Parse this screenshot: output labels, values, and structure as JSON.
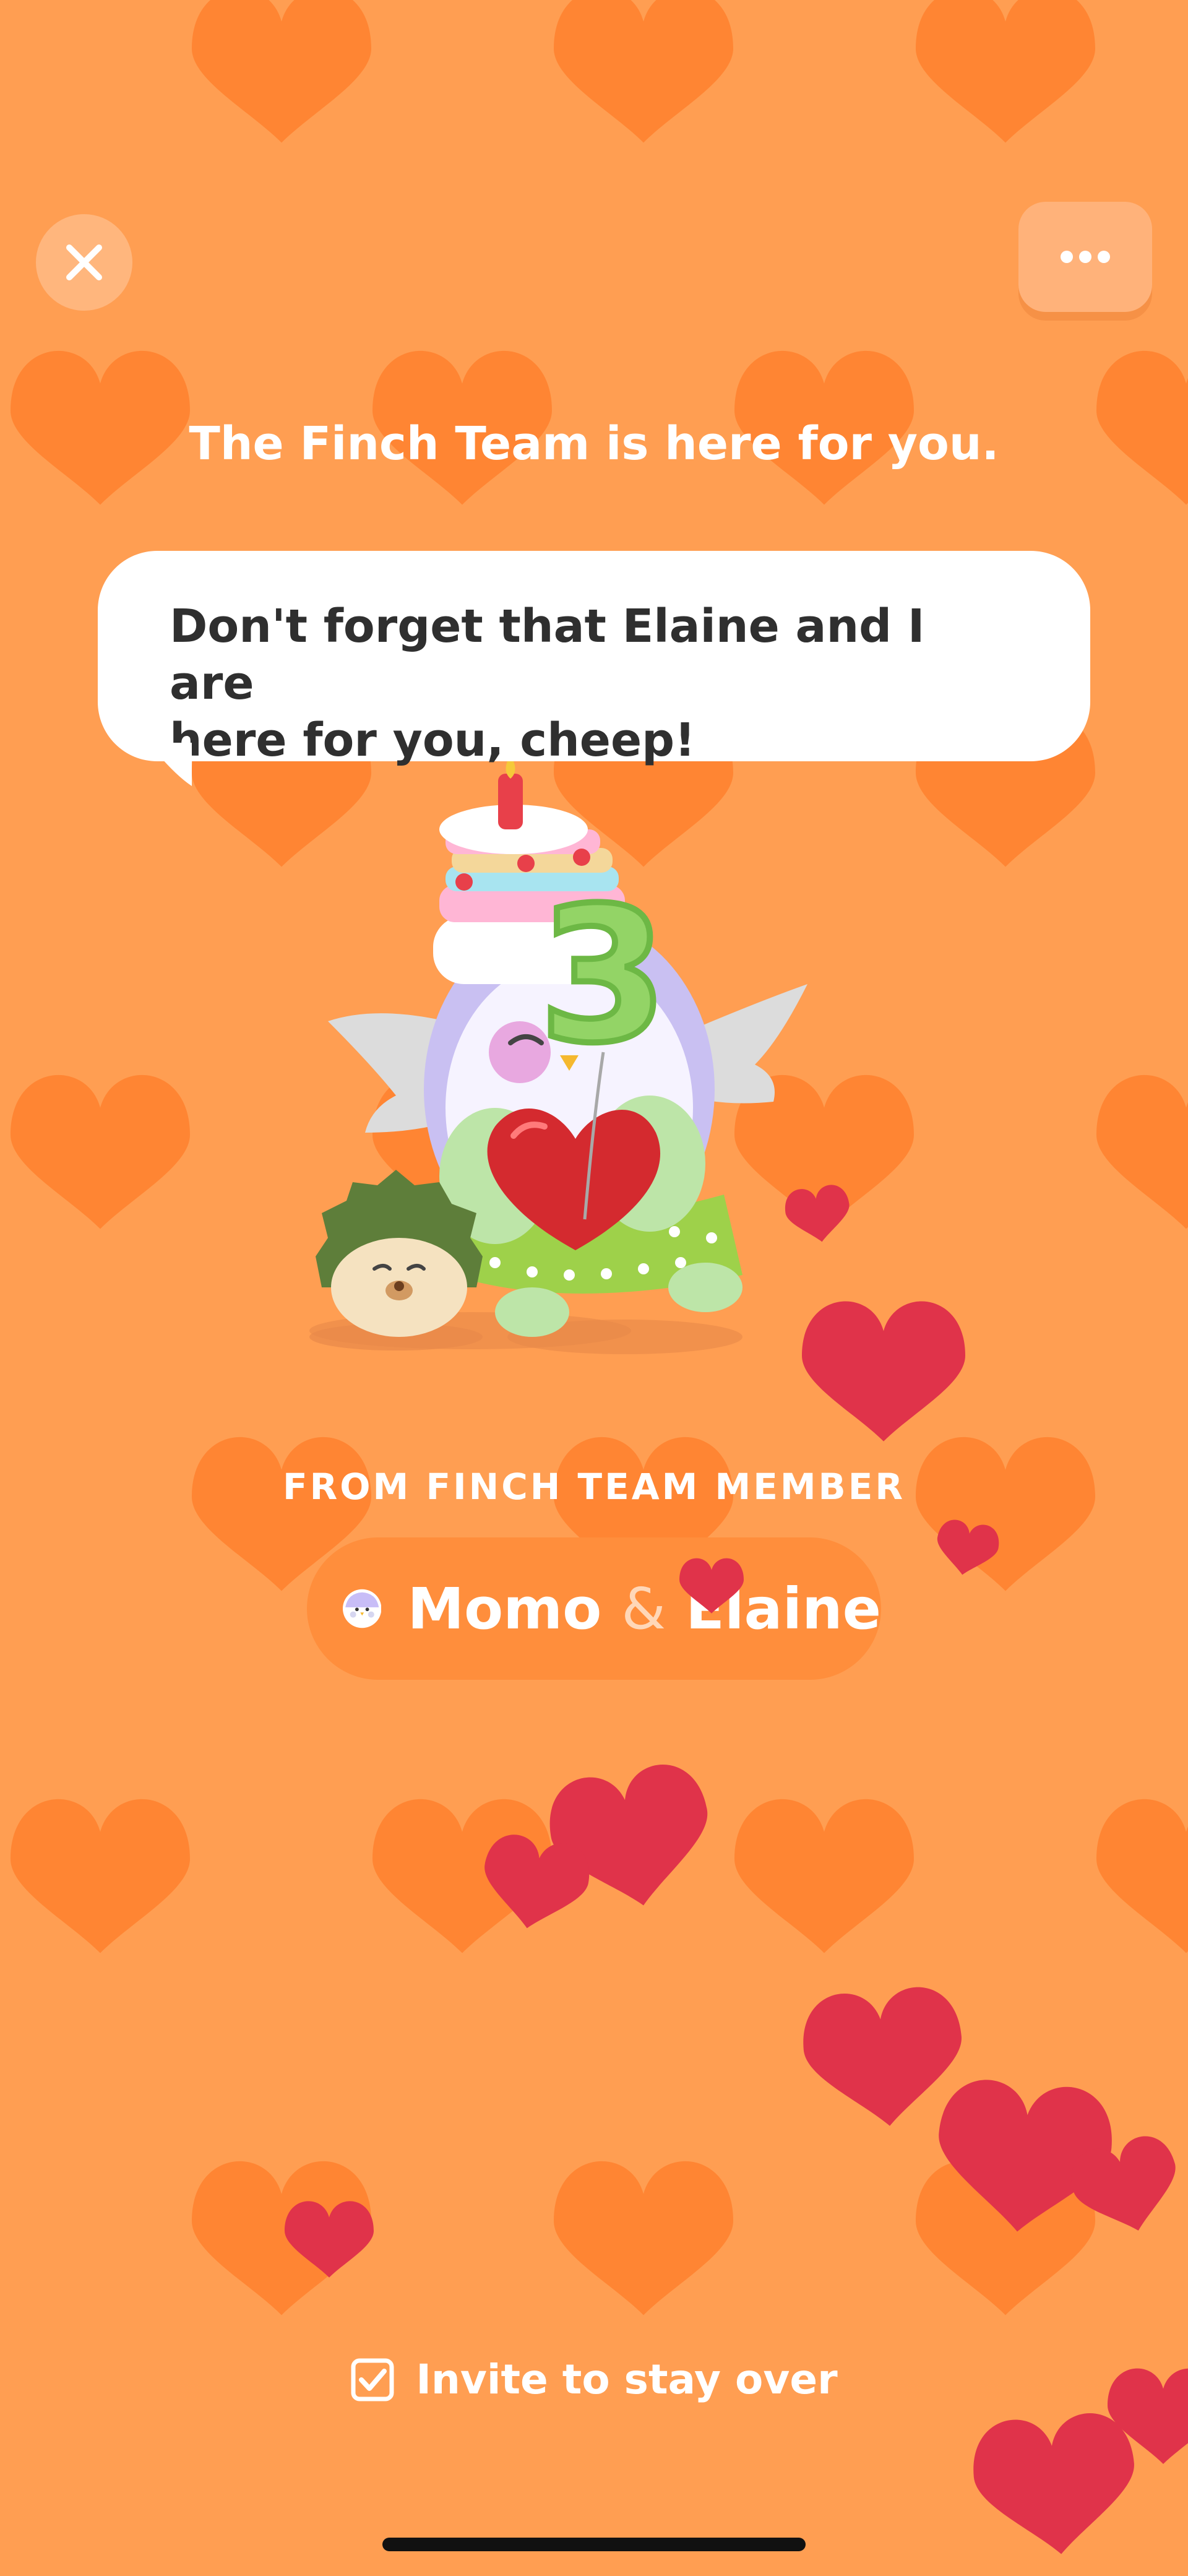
{
  "header": {
    "title": "The Finch Team is here for you."
  },
  "speech": {
    "line1": "Don't forget that Elaine and I are",
    "line2": "here for you, cheep!"
  },
  "balloon_number": "3",
  "from": {
    "label": "FROM FINCH TEAM MEMBER",
    "name_first": "Momo",
    "name_amp": "&",
    "name_second": "Elaine"
  },
  "invite": {
    "label": "Invite to stay over",
    "checked": true
  },
  "icons": {
    "close": "close-icon",
    "more": "more-icon",
    "avatar": "bird-avatar-icon",
    "checkbox": "checkbox-checked-icon"
  },
  "colors": {
    "background": "#FF9E52",
    "pattern_heart": "#FF8533",
    "float_heart": "#E0334A",
    "text_light": "#FFFFFF",
    "text_dark": "#2F2F2F"
  }
}
